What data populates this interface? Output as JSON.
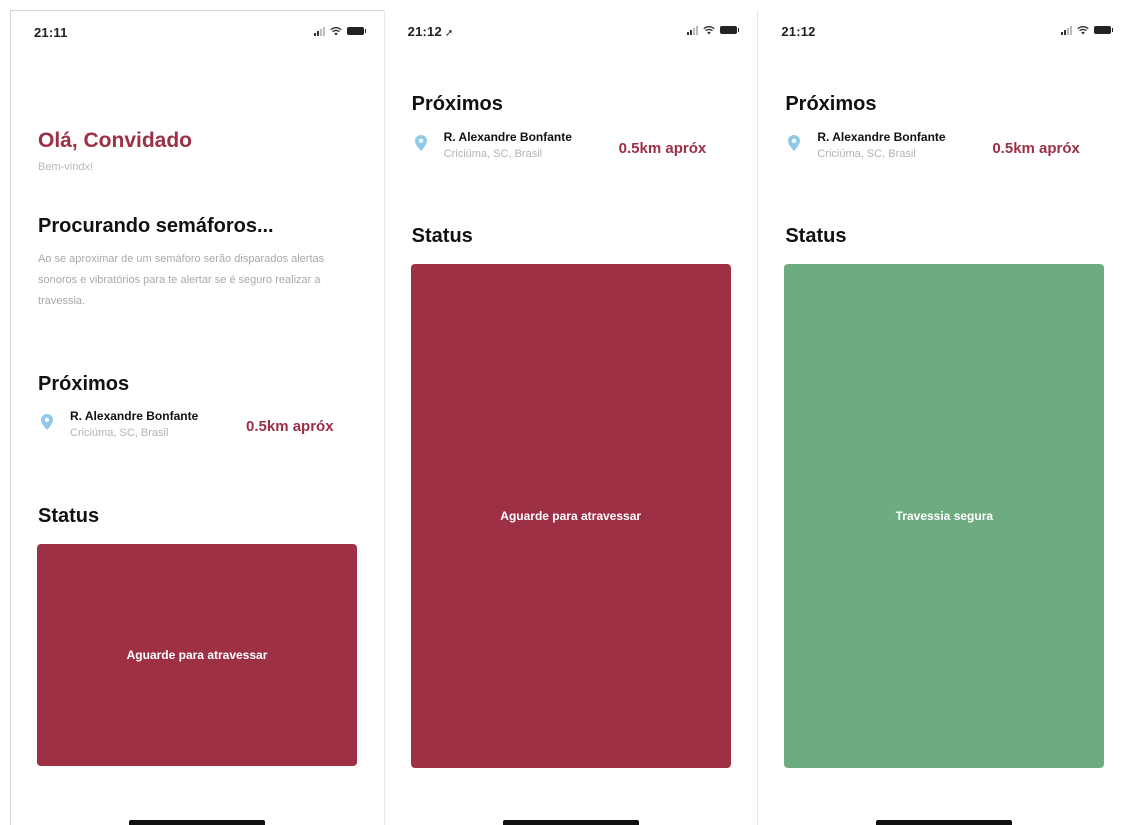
{
  "colors": {
    "accent_red": "#9d3045",
    "safe_green": "#6fab80",
    "muted_text": "#a9a9a9",
    "pin_blue": "#8fc9ea"
  },
  "screens": [
    {
      "status_bar": {
        "time": "21:11",
        "location_arrow": ""
      },
      "greeting": "Olá, Convidado",
      "welcome": "Bem-vindx!",
      "searching_title": "Procurando semáforos...",
      "searching_desc": "Ao se aproximar de um semáforo serão disparados alertas sonoros e vibratórios para te alertar se é seguro realizar a travessia.",
      "nearby_title": "Próximos",
      "nearby": {
        "street": "R. Alexandre Bonfante",
        "city": "Criciúma, SC, Brasil",
        "distance": "0.5km apróx"
      },
      "status_title": "Status",
      "status_text": "Aguarde para atravessar"
    },
    {
      "status_bar": {
        "time": "21:12",
        "location_arrow": "➚"
      },
      "nearby_title": "Próximos",
      "nearby": {
        "street": "R. Alexandre Bonfante",
        "city": "Criciúma, SC, Brasil",
        "distance": "0.5km apróx"
      },
      "status_title": "Status",
      "status_text": "Aguarde para atravessar"
    },
    {
      "status_bar": {
        "time": "21:12",
        "location_arrow": ""
      },
      "nearby_title": "Próximos",
      "nearby": {
        "street": "R. Alexandre Bonfante",
        "city": "Criciúma, SC, Brasil",
        "distance": "0.5km apróx"
      },
      "status_title": "Status",
      "status_text": "Travessia segura"
    }
  ]
}
